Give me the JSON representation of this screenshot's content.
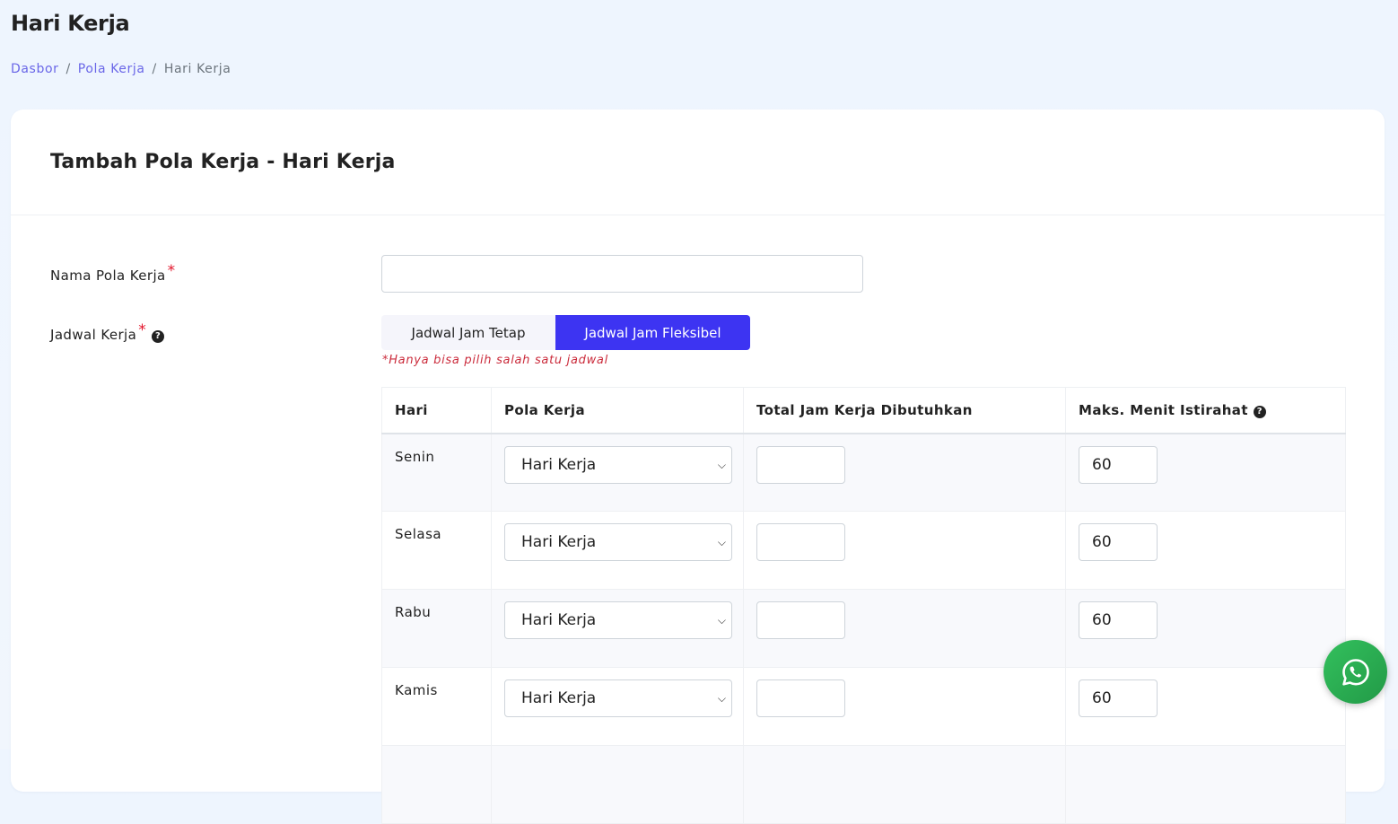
{
  "header": {
    "title": "Hari Kerja",
    "breadcrumb": [
      "Dasbor",
      "Pola Kerja",
      "Hari Kerja"
    ]
  },
  "card": {
    "title": "Tambah Pola Kerja - Hari Kerja"
  },
  "form": {
    "name_label": "Nama Pola Kerja",
    "name_value": "",
    "required_mark": "*",
    "schedule_label": "Jadwal Kerja",
    "schedule_options": [
      "Jadwal Jam Tetap",
      "Jadwal Jam Fleksibel"
    ],
    "selected_schedule": "Jadwal Jam Fleksibel",
    "schedule_note": "*Hanya bisa pilih salah satu jadwal"
  },
  "table": {
    "headers": [
      "Hari",
      "Pola Kerja",
      "Total Jam Kerja Dibutuhkan",
      "Maks. Menit Istirahat"
    ],
    "rows": [
      {
        "day": "Senin",
        "pattern": "Hari Kerja",
        "total_hours": "",
        "max_break": "60"
      },
      {
        "day": "Selasa",
        "pattern": "Hari Kerja",
        "total_hours": "",
        "max_break": "60"
      },
      {
        "day": "Rabu",
        "pattern": "Hari Kerja",
        "total_hours": "",
        "max_break": "60"
      },
      {
        "day": "Kamis",
        "pattern": "Hari Kerja",
        "total_hours": "",
        "max_break": "60"
      }
    ]
  },
  "colors": {
    "primary": "#3d34f2",
    "link": "#6a67e8",
    "required": "#e3142a",
    "note": "#cb2c3c",
    "whatsapp": "#25a94d"
  },
  "icons": {
    "help": "question-circle-icon",
    "chevron": "chevron-down-icon",
    "whatsapp": "whatsapp-icon"
  }
}
